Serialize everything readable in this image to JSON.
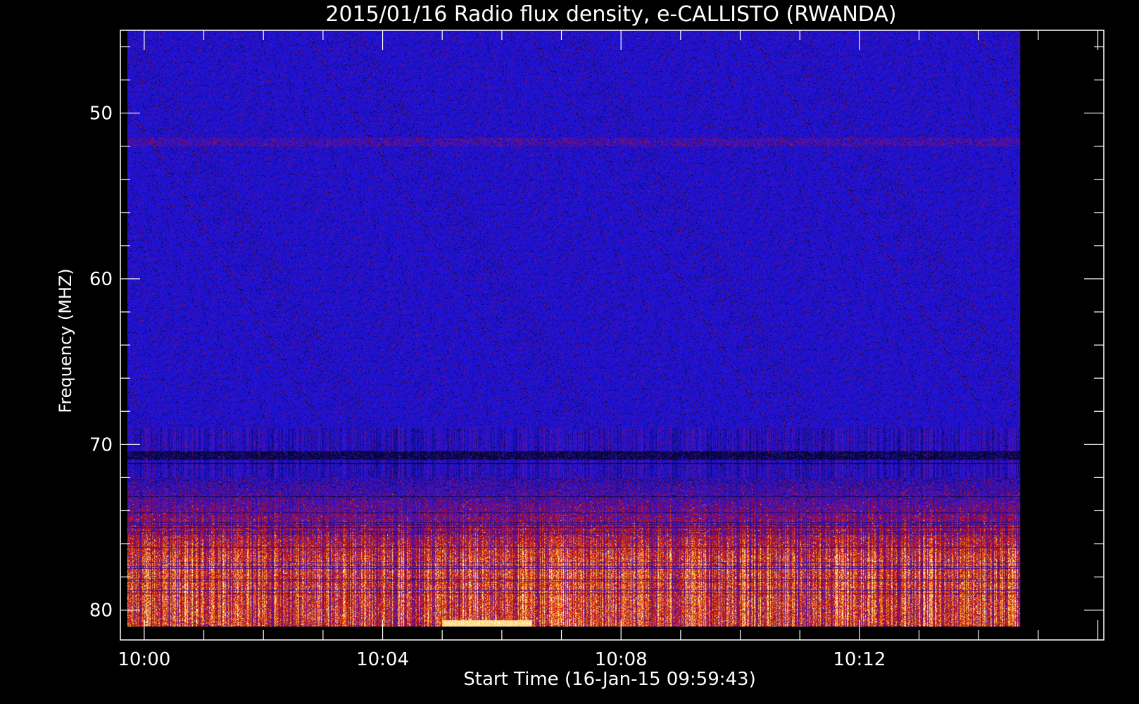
{
  "chart_data": {
    "type": "heatmap",
    "title": "2015/01/16  Radio flux density, e-CALLISTO (RWANDA)",
    "xlabel": "Start Time (16-Jan-15 09:59:43)",
    "ylabel": "Frequency (MHZ)",
    "x_ticks": [
      "10:00",
      "10:04",
      "10:08",
      "10:12"
    ],
    "x_tick_minutes": [
      0,
      4,
      8,
      12
    ],
    "xlim_minutes_after_10_00": [
      -0.4,
      16.1
    ],
    "y_ticks": [
      50,
      60,
      70,
      80
    ],
    "ylim_mhz": [
      45,
      81.8
    ],
    "y_inverted": true,
    "data_extent": {
      "time_minutes": [
        -0.28,
        14.7
      ],
      "frequency_mhz": [
        45,
        81
      ]
    },
    "colormap": [
      "#000000",
      "#0000ff",
      "#ff0000",
      "#ffff00",
      "#ffffff"
    ],
    "background_color": "#1e14e6",
    "features": [
      {
        "frequency_mhz": [
          70.4,
          70.9
        ],
        "description": "dark band"
      },
      {
        "frequency_mhz": [
          72,
          81
        ],
        "description": "strong red/orange/yellow emission"
      },
      {
        "frequency_mhz": [
          80.6,
          81
        ],
        "time_minutes": [
          5,
          6.5
        ],
        "description": "bright yellow patch"
      }
    ]
  }
}
